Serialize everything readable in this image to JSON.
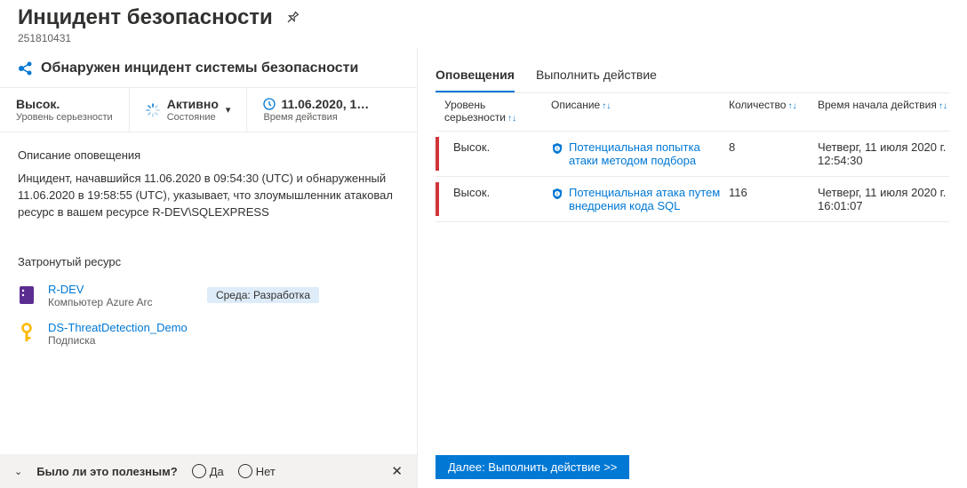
{
  "header": {
    "title": "Инцидент безопасности",
    "incident_id": "251810431"
  },
  "banner": {
    "text": "Обнаружен инцидент системы безопасности"
  },
  "status": {
    "severity_value": "Высок.",
    "severity_label": "Уровень серьезности",
    "state_value": "Активно",
    "state_label": "Состояние",
    "time_value": "11.06.2020, 1…",
    "time_label": "Время действия"
  },
  "alert_desc": {
    "heading": "Описание оповещения",
    "body": "Инцидент, начавшийся 11.06.2020 в 09:54:30 (UTC) и обнаруженный 11.06.2020 в 19:58:55 (UTC), указывает, что злоумышленник атаковал ресурс в вашем ресурсе R-DEV\\SQLEXPRESS"
  },
  "affected": {
    "heading": "Затронутый ресурс",
    "resources": [
      {
        "name": "R-DEV",
        "type": "Компьютер Azure Arc",
        "env": "Среда: Разработка",
        "icon": "server"
      },
      {
        "name": "DS-ThreatDetection_Demo",
        "type": "Подписка",
        "env": "",
        "icon": "key"
      }
    ]
  },
  "feedback": {
    "question": "Было ли это полезным?",
    "yes": "Да",
    "no": "Нет"
  },
  "tabs": {
    "alerts": "Оповещения",
    "action": "Выполнить действие"
  },
  "columns": {
    "severity_l1": "Уровень",
    "severity_l2": "серьезности",
    "description": "Описание",
    "count": "Количество",
    "start_time": "Время начала действия"
  },
  "alerts": [
    {
      "severity": "Высок.",
      "description": "Потенциальная попытка атаки методом подбора",
      "count": "8",
      "time": "Четверг, 11 июля 2020 г. 12:54:30"
    },
    {
      "severity": "Высок.",
      "description": "Потенциальная атака путем внедрения кода SQL",
      "count": "116",
      "time": "Четверг, 11 июля 2020 г. 16:01:07"
    }
  ],
  "next_button": "Далее: Выполнить действие >>"
}
